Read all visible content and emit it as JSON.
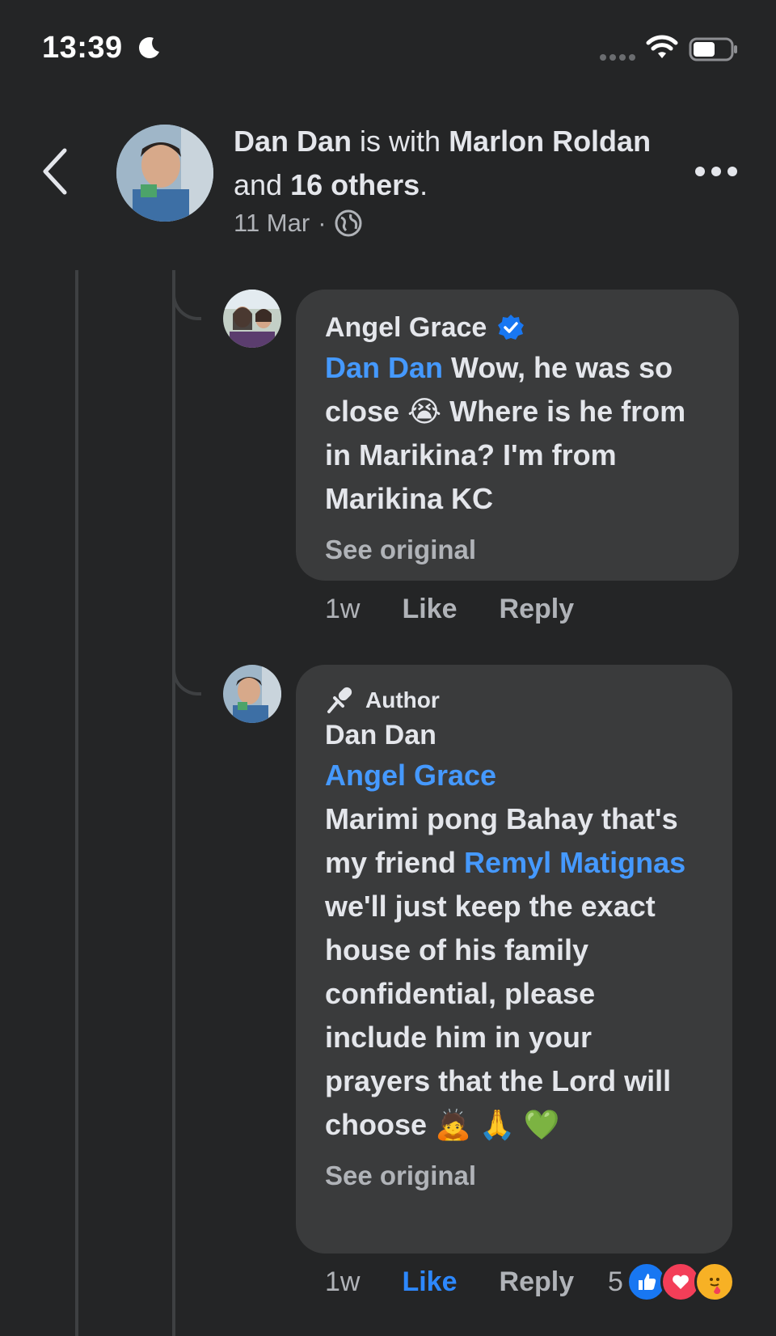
{
  "status_bar": {
    "time": "13:39"
  },
  "header": {
    "author": "Dan Dan",
    "with_text": " is with ",
    "tagged": "Marlon Roldan",
    "and_text": " and ",
    "others": "16 others",
    "period": ".",
    "date": "11 Mar",
    "separator": "·"
  },
  "comments": [
    {
      "name": "Angel Grace",
      "verified": true,
      "mention": "Dan Dan",
      "text": " Wow, he was so close 😭  Where is he from in Marikina? I'm from Marikina KC",
      "see_original": "See original",
      "time_ago": "1w",
      "like_label": "Like",
      "reply_label": "Reply"
    },
    {
      "author_tag": "Author",
      "name": "Dan Dan",
      "mention": "Angel Grace",
      "text_before": "Marimi pong Bahay that's my friend ",
      "mention2": "Remyl Matignas",
      "text_after": " we'll just keep the exact house of his family confidential, please include him in your prayers that the Lord will choose 🙇 🙏 💚",
      "see_original": "See original",
      "time_ago": "1w",
      "like_label": "Like",
      "reply_label": "Reply",
      "reaction_count": "5"
    }
  ],
  "colors": {
    "background": "#242526",
    "bubble": "#3a3b3c",
    "mention": "#4599ff",
    "like_active": "#2d88ff",
    "muted": "#b0b3b8"
  }
}
